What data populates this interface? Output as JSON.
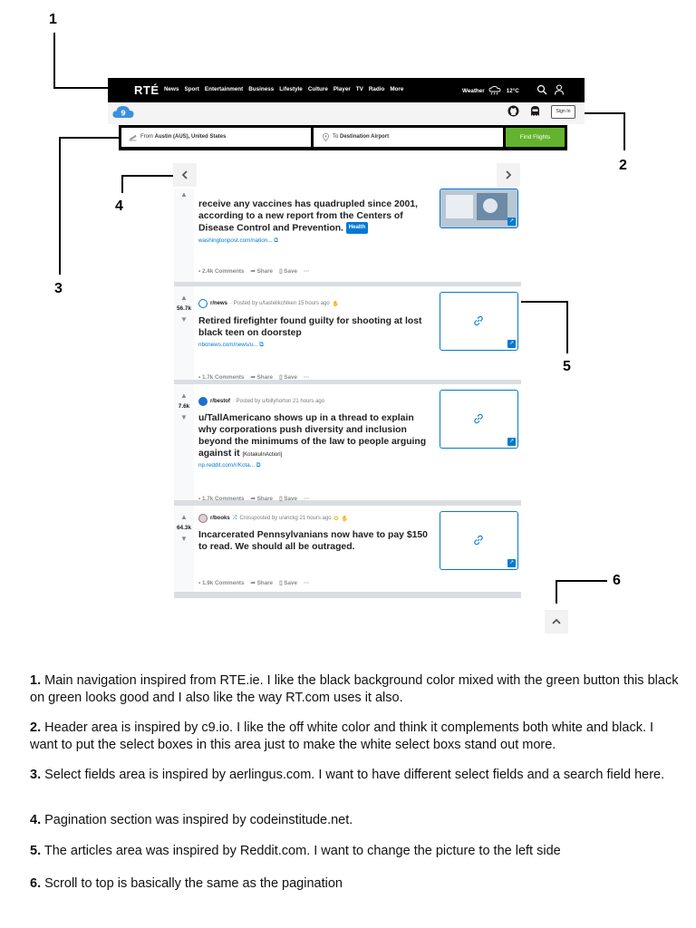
{
  "callouts": [
    "1",
    "2",
    "3",
    "4",
    "5",
    "6"
  ],
  "nav": {
    "logo": "RTÉ",
    "links": [
      "News",
      "Sport",
      "Entertainment",
      "Business",
      "Lifestyle",
      "Culture",
      "Player",
      "TV",
      "Radio",
      "More"
    ],
    "weather_label": "Weather",
    "temperature": "12°C"
  },
  "header": {
    "signin": "Sign In"
  },
  "flight_search": {
    "from_prefix": "From",
    "from_value": "Austin (AUS), United States",
    "to_prefix": "To",
    "to_value": "Destination Airport",
    "button": "Find Flights"
  },
  "posts": [
    {
      "title": "receive any vaccines has quadrupled since 2001, according to a new report from the Centers of Disease Control and Prevention.",
      "flair": "Health",
      "domain": "washingtonpost.com/nation...",
      "comments": "2.4k Comments",
      "share": "Share",
      "save": "Save"
    },
    {
      "score": "56.7k",
      "subreddit": "r/news",
      "posted": "· Posted by u/tastelikchiken 15 hours ago",
      "title": "Retired firefighter found guilty for shooting at lost black teen on doorstep",
      "domain": "nbcnews.com/news/u...",
      "comments": "1.7k Comments",
      "share": "Share",
      "save": "Save"
    },
    {
      "score": "7.6k",
      "subreddit": "r/bestof",
      "posted": "· Posted by u/billyhorton 21 hours ago",
      "title": "u/TallAmericano shows up in a thread to explain why corporations push diversity and inclusion beyond the minimums of the law to people arguing against it",
      "tag": "[KotakuInAction]",
      "domain": "np.reddit.com/r/Kota...",
      "comments": "1.7k Comments",
      "share": "Share",
      "save": "Save"
    },
    {
      "score": "64.3k",
      "subreddit": "r/books",
      "posted": "Crossposted by u/arickg 21 hours ago",
      "title": "Incarcerated Pennsylvanians now have to pay $150 to read. We should all be outraged.",
      "comments": "1.9k Comments",
      "share": "Share",
      "save": "Save"
    }
  ],
  "notes": [
    {
      "num": "1.",
      "text": "Main navigation inspired from RTE.ie. I like the black background color mixed with the green button this black on green looks good and I also like the way RT.com uses it also."
    },
    {
      "num": "2.",
      "text": "Header area is inspired by c9.io. I like the off white color and think it complements both white and black. I want to put the select boxes in this area just to make the white select boxs stand out more."
    },
    {
      "num": "3.",
      "text": "Select fields area is inspired by aerlingus.com. I want to have different select fields and a search field here."
    },
    {
      "num": "4.",
      "text": "Pagination section was inspired by codeinstitude.net."
    },
    {
      "num": "5.",
      "text": "The articles area was inspired by Reddit.com. I want to change the picture to the left side"
    },
    {
      "num": "6.",
      "text": "Scroll to top is basically the same as the pagination"
    }
  ],
  "colors": {
    "nav_bg": "#000000",
    "header_bg": "#f4f4f4",
    "accent_green": "#64b32e",
    "reddit_blue": "#0079d3"
  }
}
